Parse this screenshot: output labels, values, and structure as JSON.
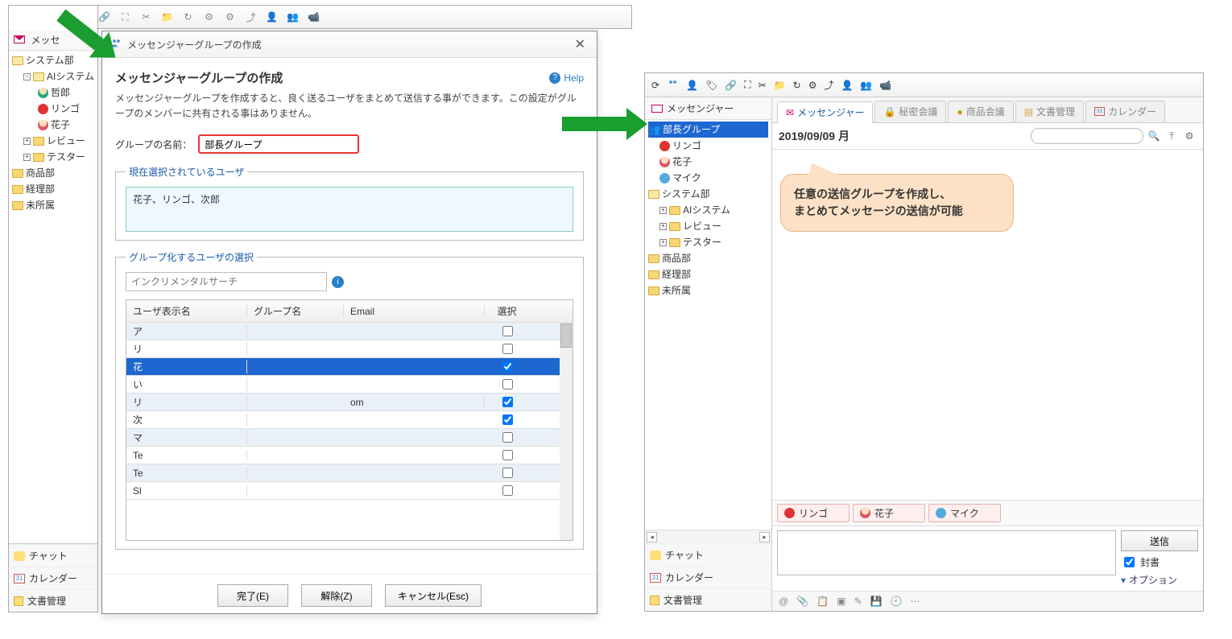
{
  "left": {
    "messenger_title": "メッセ",
    "tree": {
      "systembu": "システム部",
      "ai": "AIシステム",
      "tetsuro": "哲郎",
      "ringo": "リンゴ",
      "hanako": "花子",
      "review": "レビュー",
      "tester": "テスター",
      "shohinbu": "商品部",
      "keiribu": "経理部",
      "mishozoku": "未所属"
    },
    "bottom": {
      "chat": "チャット",
      "calendar": "カレンダー",
      "docs": "文書管理",
      "cal_num": "31"
    }
  },
  "dialog": {
    "titlebar": "メッセンジャーグループの作成",
    "heading": "メッセンジャーグループの作成",
    "help": "Help",
    "desc": "メッセンジャーグループを作成すると、良く送るユーザをまとめて送信する事ができます。この設定がグループのメンバーに共有される事はありません。",
    "name_label": "グループの名前：",
    "name_value": "部長グループ",
    "selected_legend": "現在選択されているユーザ",
    "selected_text": "花子、リンゴ、次郎",
    "pick_legend": "グループ化するユーザの選択",
    "search_placeholder": "インクリメンタルサーチ",
    "thead": {
      "c1": "ユーザ表示名",
      "c2": "グループ名",
      "c3": "Email",
      "c4": "選択"
    },
    "rows": [
      {
        "c1": "ア",
        "c2": "",
        "c3": "",
        "checked": false,
        "sel": false
      },
      {
        "c1": "リ",
        "c2": "",
        "c3": "",
        "checked": false,
        "sel": false
      },
      {
        "c1": "花",
        "c2": "",
        "c3": "",
        "checked": true,
        "sel": true
      },
      {
        "c1": "い",
        "c2": "",
        "c3": "",
        "checked": false,
        "sel": false
      },
      {
        "c1": "リ",
        "c2": "",
        "c3": "om",
        "checked": true,
        "sel": false
      },
      {
        "c1": "次",
        "c2": "",
        "c3": "",
        "checked": true,
        "sel": false
      },
      {
        "c1": "マ",
        "c2": "",
        "c3": "",
        "checked": false,
        "sel": false
      },
      {
        "c1": "Te",
        "c2": "",
        "c3": "",
        "checked": false,
        "sel": false
      },
      {
        "c1": "Te",
        "c2": "",
        "c3": "",
        "checked": false,
        "sel": false
      },
      {
        "c1": "Sl",
        "c2": "",
        "c3": "",
        "checked": false,
        "sel": false
      }
    ],
    "btns": {
      "done": "完了(E)",
      "clear": "解除(Z)",
      "cancel": "キャンセル(Esc)"
    }
  },
  "right": {
    "side_title": "メッセンジャー",
    "tree": {
      "group_sel": "部長グループ",
      "ringo": "リンゴ",
      "hanako": "花子",
      "mike": "マイク",
      "systembu": "システム部",
      "ai": "AIシステム",
      "review": "レビュー",
      "tester": "テスター",
      "shohinbu": "商品部",
      "keiribu": "経理部",
      "mishozoku": "未所属"
    },
    "side_bottom": {
      "chat": "チャット",
      "calendar": "カレンダー",
      "docs": "文書管理",
      "cal_num": "31"
    },
    "tabs": {
      "messenger": "メッセンジャー",
      "secret": "秘密会議",
      "product": "商品会議",
      "docs": "文書管理",
      "calendar": "カレンダー",
      "cal_num": "31"
    },
    "date": "2019/09/09 月",
    "callout_l1": "任意の送信グループを作成し、",
    "callout_l2": "まとめてメッセージの送信が可能",
    "recipients": {
      "ringo": "リンゴ",
      "hanako": "花子",
      "mike": "マイク"
    },
    "send": "送信",
    "seal": "封書",
    "option": "オプション"
  }
}
